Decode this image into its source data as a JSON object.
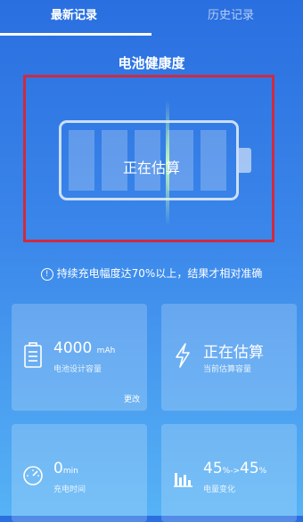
{
  "tabs": {
    "latest": "最新记录",
    "history": "历史记录"
  },
  "title": "电池健康度",
  "battery": {
    "status_text": "正在估算",
    "cells_total": 5
  },
  "tip": {
    "icon": "info-icon",
    "text": "持续充电幅度达70%以上，结果才相对准确"
  },
  "cards": {
    "design_capacity": {
      "icon": "battery-icon",
      "value": "4000",
      "unit": "mAh",
      "label": "电池设计容量",
      "action": "更改"
    },
    "current_capacity": {
      "icon": "lightning-icon",
      "value": "正在估算",
      "label": "当前估算容量"
    },
    "charge_time": {
      "icon": "speedometer-icon",
      "value": "0",
      "unit": "min",
      "label": "充电时间"
    },
    "charge_change": {
      "icon": "bar-chart-icon",
      "from_value": "45",
      "from_unit": "%",
      "arrow": "->",
      "to_value": "45",
      "to_unit": "%",
      "label": "电量变化"
    }
  },
  "colors": {
    "background_top": "#2a6fe0",
    "background_bottom": "#56b2f5",
    "highlight_border": "#d02a3f",
    "scan_line": "#c8ffb4"
  }
}
